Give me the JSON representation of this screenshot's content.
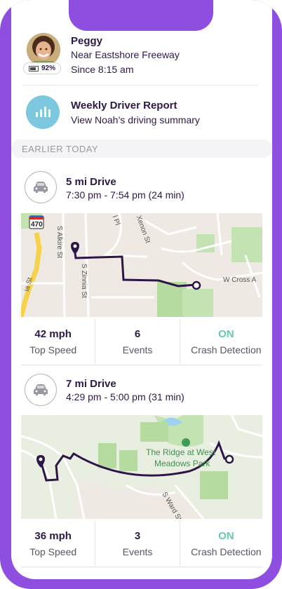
{
  "profile": {
    "name": "Peggy",
    "location": "Near Eastshore Freeway",
    "since": "Since 8:15 am",
    "battery": "92%"
  },
  "report": {
    "title": "Weekly Driver Report",
    "subtitle": "View Noah’s driving summary"
  },
  "section": {
    "label": "EARLIER TODAY"
  },
  "drives": [
    {
      "title": "5 mi Drive",
      "time": "7:30 pm - 7:54 pm (24 min)",
      "map_labels": [
        "470",
        "S Alkire St",
        "S Zinnia St",
        "Xenon St",
        "W Cross A",
        "ia St",
        "l Pl"
      ],
      "stats": [
        {
          "value": "42 mph",
          "label": "Top Speed"
        },
        {
          "value": "6",
          "label": "Events"
        },
        {
          "value": "ON",
          "label": "Crash Detection"
        }
      ]
    },
    {
      "title": "7 mi Drive",
      "time": "4:29 pm - 5:00 pm (31 min)",
      "map_labels": [
        "The Ridge at West",
        "Meadows Park",
        "S Ward St"
      ],
      "stats": [
        {
          "value": "36 mph",
          "label": "Top Speed"
        },
        {
          "value": "3",
          "label": "Events"
        },
        {
          "value": "ON",
          "label": "Crash Detection"
        }
      ]
    }
  ],
  "colors": {
    "frame": "#8e4fe0",
    "route": "#2e1547",
    "on": "#66c9a9",
    "report_icon": "#7dc8e0"
  }
}
